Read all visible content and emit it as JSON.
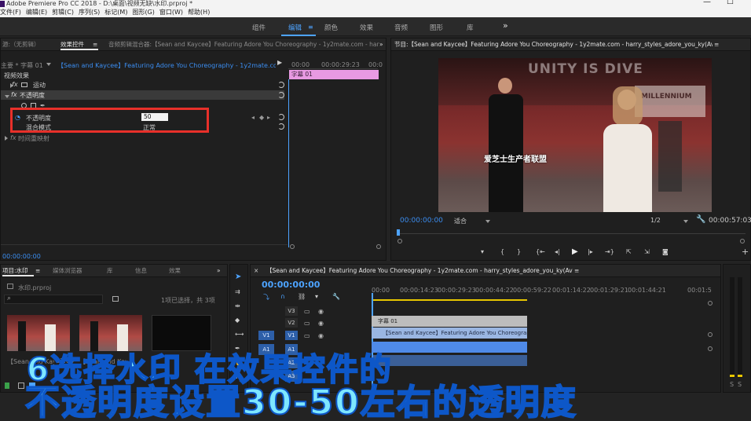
{
  "window": {
    "title": "Adobe Premiere Pro CC 2018 - D:\\桌面\\视频无缺\\水印.prproj *",
    "minimize": "—",
    "maximize": "☐"
  },
  "menu": [
    "文件(F)",
    "编辑(E)",
    "剪辑(C)",
    "序列(S)",
    "标记(M)",
    "图形(G)",
    "窗口(W)",
    "帮助(H)"
  ],
  "workspaces": {
    "tabs": [
      "组件",
      "编辑",
      "颜色",
      "效果",
      "音频",
      "图形",
      "库"
    ],
    "active": "编辑",
    "more": "»"
  },
  "effect_controls": {
    "tabs": [
      "源:（无剪辑）",
      "效果控件",
      "音频剪辑混合器:【Sean and Kaycee】Featuring Adore You Choreography - 1y2mate.com - harry_st"
    ],
    "master": "主要 * 字幕 01",
    "clip": "【Sean and Kaycee】Featuring Adore You Choreography - 1y2mate.com - harry_style...",
    "ruler_start": "00:00",
    "ruler_mid": "00:00:29:23",
    "ruler_end": "00:0",
    "clip_label": "字幕 01",
    "section_video": "视频效果",
    "motion": "运动",
    "opacity_group": "不透明度",
    "opacity_label": "不透明度",
    "opacity_value": "50",
    "blend_label": "混合模式",
    "blend_value": "正常",
    "time_remap": "时间重映射",
    "fx": "fx",
    "timecode": "00:00:00:00"
  },
  "program": {
    "title": "节目:【Sean and Kaycee】Featuring Adore You Choreography - 1y2mate.com - harry_styles_adore_you_ky(Av87486750,P1)",
    "timecode": "00:00:00:00",
    "fit": "适合",
    "ratio": "1/2",
    "duration": "00:00:57:03",
    "watermark": "爱芝士生产者联盟",
    "wall_text": "UNITY IS DIVE",
    "banner_text": "MILLENNIUM",
    "add": "+"
  },
  "project": {
    "tabs": [
      "项目:水印",
      "媒体浏览器",
      "库",
      "信息",
      "效果"
    ],
    "file": "水印.prproj",
    "selection": "1项已选择，共 3项",
    "thumb_label": "【Sean and Kaycee...",
    "thumb_dur": "57:03"
  },
  "timeline": {
    "title": "【Sean and Kaycee】Featuring Adore You Choreography - 1y2mate.com - harry_styles_adore_you_ky(Av87486750,P1)",
    "timecode": "00:00:00:00",
    "ruler": [
      "00:00",
      "00:00:14:23",
      "00:00:29:23",
      "00:00:44:22",
      "00:00:59:22",
      "00:01:14:22",
      "00:01:29:21",
      "00:01:44:21",
      "00:01:5"
    ],
    "tracks": [
      "V3",
      "V2",
      "V1",
      "A1",
      "A2",
      "A3"
    ],
    "src_v": "V1",
    "src_a": "A1",
    "title_clip": "字幕 01",
    "video_clip": "【Sean and Kaycee】Featuring Adore You Choreography - 1y2mate",
    "meter_label": "S"
  },
  "caption": {
    "line1": "6选择水印 在效果控件的",
    "line2": "不透明度设置30-50左右的透明度"
  },
  "colors": {
    "accent": "#4da3ff",
    "highlight": "#e8302a",
    "title_clip": "#e89ae2",
    "caption_fill": "#7ee7ff",
    "caption_stroke": "#0d57c8"
  }
}
